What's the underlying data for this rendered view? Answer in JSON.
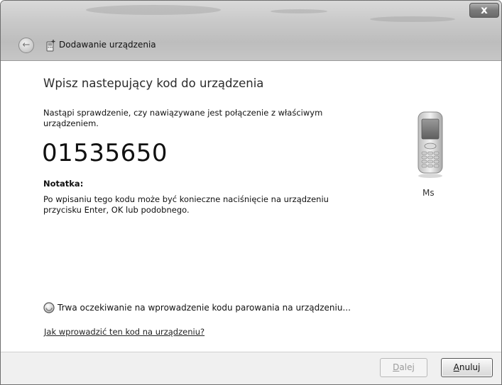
{
  "window": {
    "close_label": "x"
  },
  "header": {
    "back_icon": "back-arrow-icon",
    "wizard_icon": "device-add-icon",
    "title": "Dodawanie urządzenia"
  },
  "main": {
    "heading": "Wpisz nastepujący kod do urządzenia",
    "description": "Nastąpi sprawdzenie, czy nawiązywane jest połączenie z właściwym urządzeniem.",
    "pairing_code": "01535650",
    "note_label": "Notatka:",
    "note_text": "Po wpisaniu tego kodu może być konieczne naciśnięcie na urządzeniu przycisku Enter, OK lub podobnego."
  },
  "device": {
    "icon": "mobile-phone-icon",
    "name": "Ms"
  },
  "status": {
    "icon": "busy-spinner-icon",
    "text": "Trwa oczekiwanie na wprowadzenie kodu parowania na urządzeniu..."
  },
  "help_link": "Jak wprowadzić ten kod na urządzeniu?",
  "footer": {
    "next_mnemonic": "D",
    "next_rest": "alej",
    "cancel_mnemonic": "A",
    "cancel_rest": "nuluj",
    "next_enabled": false
  }
}
